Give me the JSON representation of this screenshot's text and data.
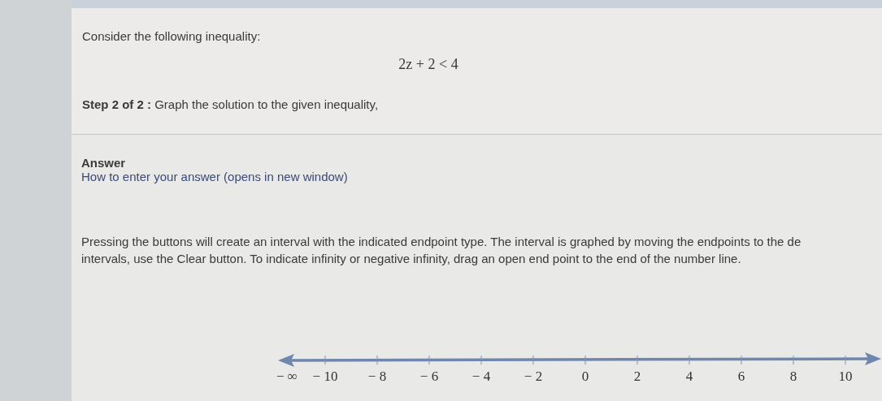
{
  "question": {
    "prompt": "Consider the following inequality:",
    "inequality": "2z + 2 < 4",
    "step": "**Step 2 of 2 :** Graph the solution to the given inequality,"
  },
  "answer": {
    "heading": "Answer",
    "help_link": "How to enter your answer (opens in new window)",
    "instructions": [
      "Pressing the buttons will create an interval with the indicated endpoint type. The interval is graphed by moving the endpoints to the de",
      "intervals, use the Clear button. To indicate infinity or negative infinity, drag an open end point to the end of the number line."
    ],
    "number_line": {
      "infinity_label": "− ∞",
      "labels": [
        "− 10",
        "− 8",
        "− 6",
        "− 4",
        "− 2",
        "0",
        "2",
        "4",
        "6",
        "8",
        "10"
      ]
    }
  }
}
